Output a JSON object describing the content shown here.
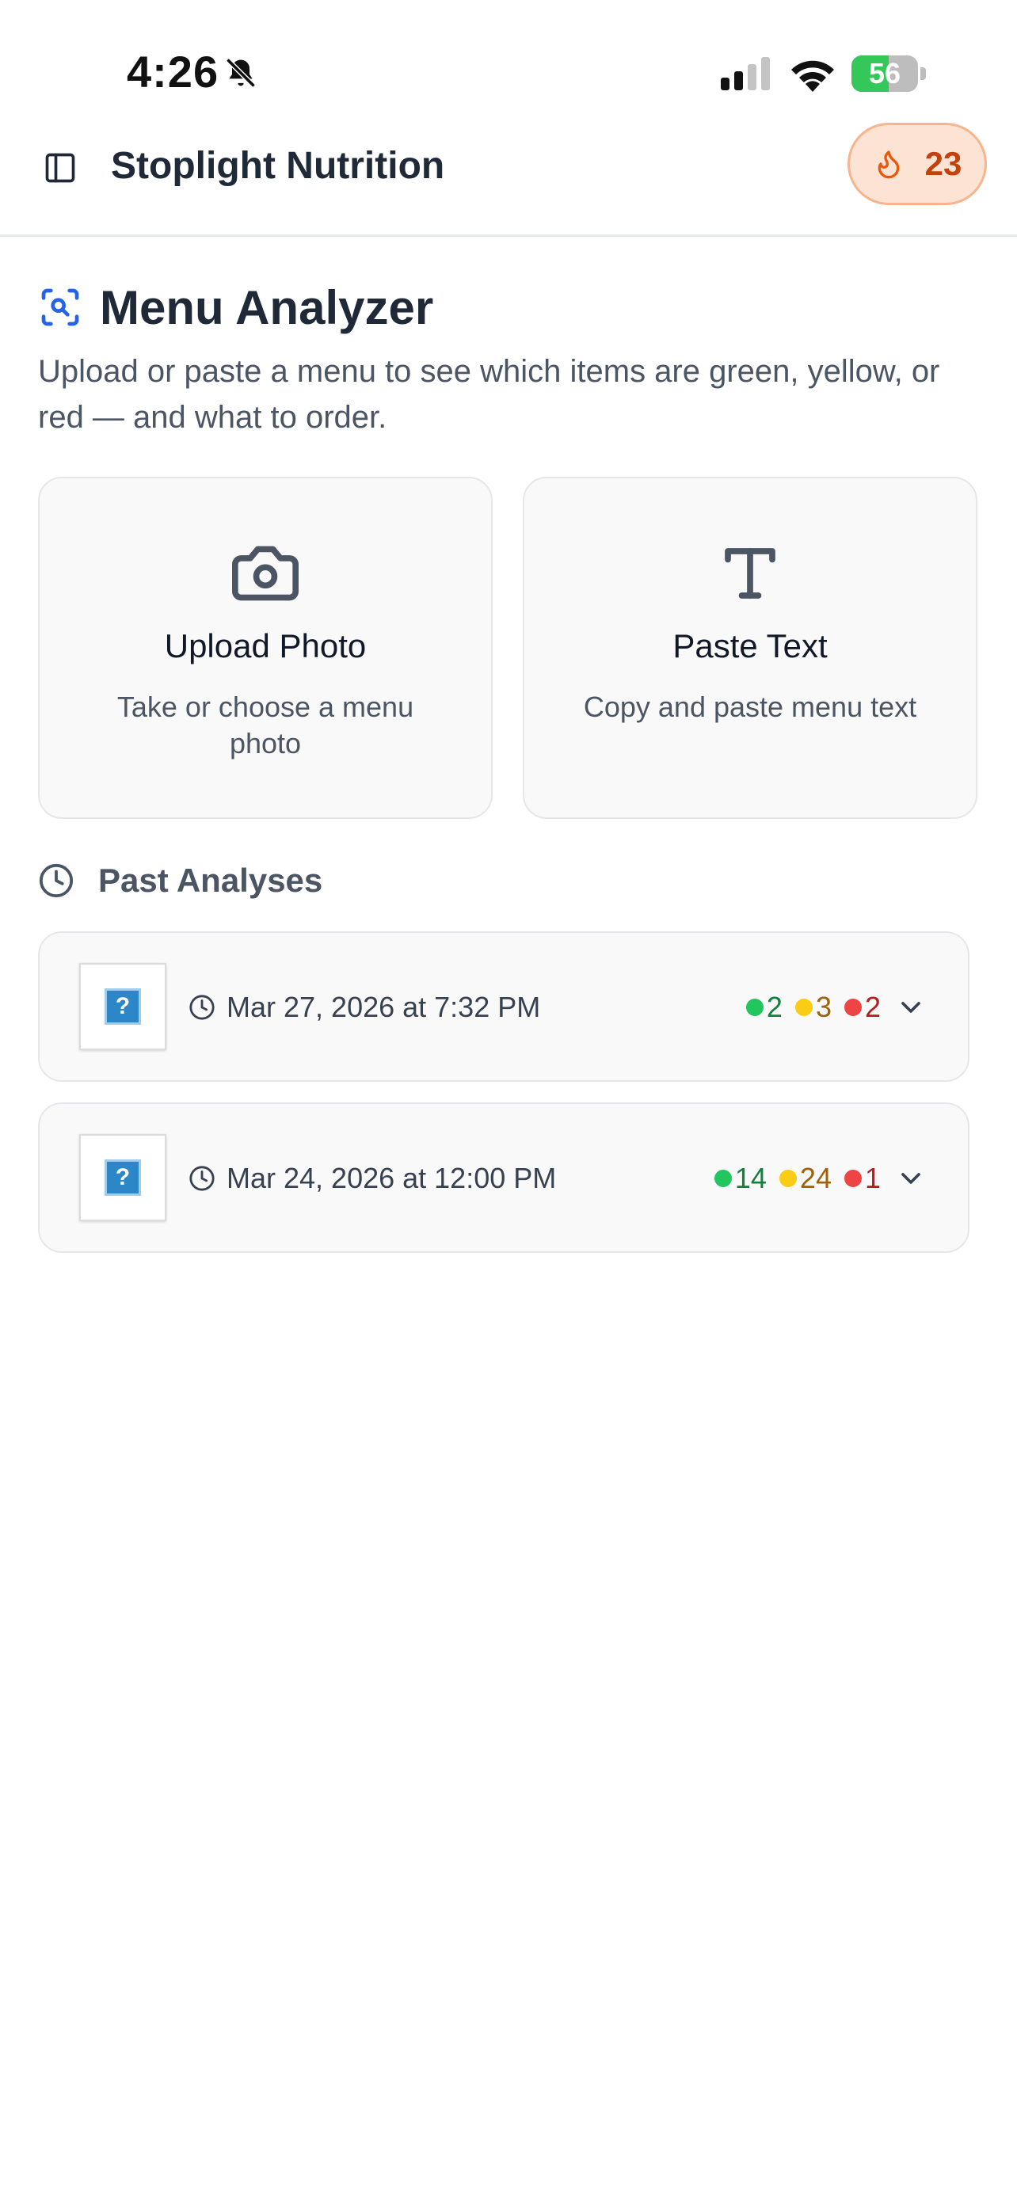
{
  "status_bar": {
    "time": "4:26",
    "battery_percent": 56,
    "battery_label": "56"
  },
  "header": {
    "title": "Stoplight Nutrition",
    "streak_count": "23"
  },
  "page": {
    "title": "Menu Analyzer",
    "subtitle": "Upload or paste a menu to see which items are green, yellow, or red — and what to order."
  },
  "options": [
    {
      "title": "Upload Photo",
      "description": "Take or choose a menu photo",
      "icon": "camera-icon"
    },
    {
      "title": "Paste Text",
      "description": "Copy and paste menu text",
      "icon": "text-icon"
    }
  ],
  "past": {
    "heading": "Past Analyses",
    "items": [
      {
        "date": "Mar 27, 2026 at 7:32 PM",
        "green": "2",
        "yellow": "3",
        "red": "2"
      },
      {
        "date": "Mar 24, 2026 at 12:00 PM",
        "green": "14",
        "yellow": "24",
        "red": "1"
      }
    ]
  },
  "colors": {
    "green": "#22c55e",
    "green_text": "#15803d",
    "yellow": "#facc15",
    "yellow_text": "#a16207",
    "red": "#ef4444",
    "red_text": "#b91c1c",
    "accent_blue": "#2563eb",
    "streak_bg": "#fde3d3",
    "streak_text": "#c2410c"
  }
}
